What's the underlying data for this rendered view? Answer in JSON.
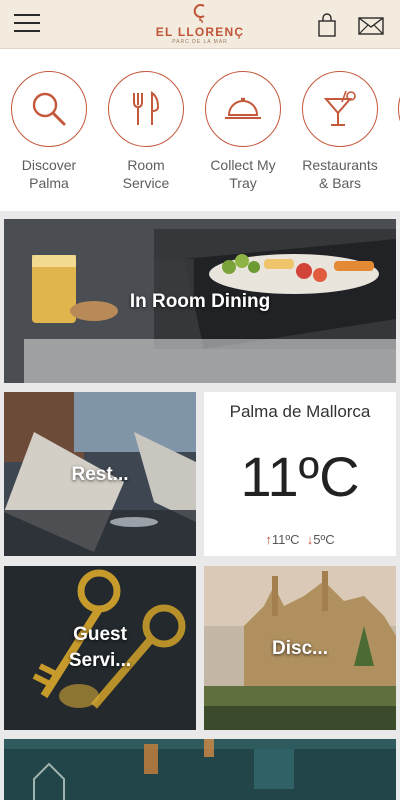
{
  "header": {
    "brand_name": "EL LLORENÇ",
    "brand_tagline": "PARC DE LA MAR",
    "menu_icon": "hamburger-menu-icon",
    "bag_icon": "shopping-bag-icon",
    "mail_icon": "envelope-icon"
  },
  "quick_actions": [
    {
      "label_line1": "Discover",
      "label_line2": "Palma",
      "icon": "magnifier-icon"
    },
    {
      "label_line1": "Room",
      "label_line2": "Service",
      "icon": "fork-knife-icon"
    },
    {
      "label_line1": "Collect My",
      "label_line2": "Tray",
      "icon": "cloche-icon"
    },
    {
      "label_line1": "Restaurants",
      "label_line2": "& Bars",
      "icon": "cocktail-icon"
    }
  ],
  "tiles": {
    "in_room_dining": "In Room Dining",
    "restaurants": "Rest...",
    "guest_services_line1": "Guest",
    "guest_services_line2": "Servi...",
    "discover": "Disc..."
  },
  "weather": {
    "city": "Palma de Mallorca",
    "temperature": "11ºC",
    "high": "11ºC",
    "low": "5ºC"
  },
  "colors": {
    "accent": "#c4583b",
    "header_bg": "#f3ebdd"
  }
}
